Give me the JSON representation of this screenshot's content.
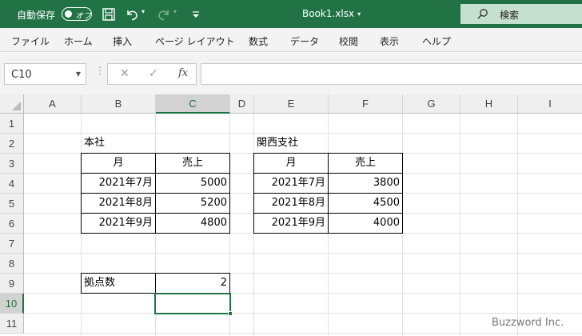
{
  "titlebar": {
    "autosave_label": "自動保存",
    "autosave_state": "オフ",
    "doc_title": "Book1.xlsx",
    "search_label": "検索",
    "bg_color": "#217346"
  },
  "menu": [
    "ファイル",
    "ホーム",
    "挿入",
    "ページ レイアウト",
    "数式",
    "データ",
    "校閲",
    "表示",
    "ヘルプ"
  ],
  "formula_bar": {
    "name_box": "C10",
    "formula": ""
  },
  "columns": [
    "A",
    "B",
    "C",
    "D",
    "E",
    "F",
    "G",
    "H",
    "I"
  ],
  "rows": [
    "1",
    "2",
    "3",
    "4",
    "5",
    "6",
    "7",
    "8",
    "9",
    "10",
    "11"
  ],
  "active_cell": "C10",
  "cells": {
    "B2": "本社",
    "B3": "月",
    "C3": "売上",
    "B4": "2021年7月",
    "C4": "5000",
    "B5": "2021年8月",
    "C5": "5200",
    "B6": "2021年9月",
    "C6": "4800",
    "E2": "関西支社",
    "E3": "月",
    "F3": "売上",
    "E4": "2021年7月",
    "F4": "3800",
    "E5": "2021年8月",
    "F5": "4500",
    "E6": "2021年9月",
    "F6": "4000",
    "B9": "拠点数",
    "C9": "2"
  },
  "watermark": "Buzzword Inc."
}
